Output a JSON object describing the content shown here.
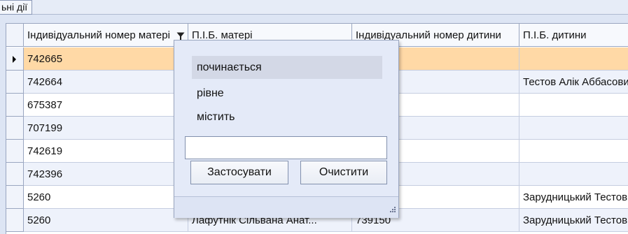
{
  "toolbar": {
    "actions_label": "ьні дії"
  },
  "grid": {
    "columns": [
      "Індивідуальний номер матері",
      "П.І.Б. матері",
      "Індивідуальний номер дитини",
      "П.І.Б. дитини"
    ],
    "rows": [
      {
        "mother_id": "742665",
        "mother_name": "",
        "child_id": "",
        "child_name": "",
        "selected": true
      },
      {
        "mother_id": "742664",
        "mother_name": "",
        "child_id": "",
        "child_name": "Тестов Алік Аббасович"
      },
      {
        "mother_id": "675387",
        "mother_name": "",
        "child_id": "",
        "child_name": ""
      },
      {
        "mother_id": "707199",
        "mother_name": "",
        "child_id": "",
        "child_name": ""
      },
      {
        "mother_id": "742619",
        "mother_name": "",
        "child_id": "",
        "child_name": ""
      },
      {
        "mother_id": "742396",
        "mother_name": "",
        "child_id": "",
        "child_name": ""
      },
      {
        "mother_id": "5260",
        "mother_name": "",
        "child_id": "",
        "child_name": "Зарудницький Тестов"
      },
      {
        "mother_id": "5260",
        "mother_name": "Лафутнік Сільвана Анат...",
        "child_id": "739150",
        "child_name": "Зарудницький Тестов"
      }
    ]
  },
  "filter_popup": {
    "options": [
      "починається",
      "рівне",
      "містить"
    ],
    "selected_option": "починається",
    "text_value": "",
    "apply_label": "Застосувати",
    "clear_label": "Очистити"
  },
  "colors": {
    "selected_row": "#ffd9a6",
    "alt_row": "#eef2fb",
    "popup_bg": "#e4eaf8"
  }
}
